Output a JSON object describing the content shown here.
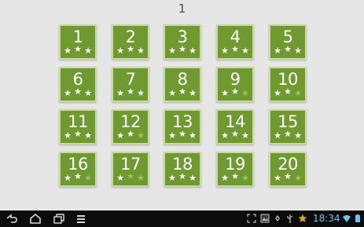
{
  "page": {
    "number": "1"
  },
  "levels": [
    {
      "label": "1",
      "stars": 3
    },
    {
      "label": "2",
      "stars": 3
    },
    {
      "label": "3",
      "stars": 3
    },
    {
      "label": "4",
      "stars": 3
    },
    {
      "label": "5",
      "stars": 3
    },
    {
      "label": "6",
      "stars": 3
    },
    {
      "label": "7",
      "stars": 3
    },
    {
      "label": "8",
      "stars": 3
    },
    {
      "label": "9",
      "stars": 2
    },
    {
      "label": "10",
      "stars": 2
    },
    {
      "label": "11",
      "stars": 3
    },
    {
      "label": "12",
      "stars": 2
    },
    {
      "label": "13",
      "stars": 3
    },
    {
      "label": "14",
      "stars": 3
    },
    {
      "label": "15",
      "stars": 3
    },
    {
      "label": "16",
      "stars": 2
    },
    {
      "label": "17",
      "stars": 1
    },
    {
      "label": "18",
      "stars": 3
    },
    {
      "label": "19",
      "stars": 2
    },
    {
      "label": "20",
      "stars": 2
    }
  ],
  "status_bar": {
    "time": "18:34"
  },
  "colors": {
    "tile": "#6e9a2f",
    "tile_border": "#c9dca0",
    "star_on": "#ffffff",
    "star_off": "#9ec25f",
    "clock": "#6fc3ea"
  },
  "icons": [
    "back-icon",
    "home-icon",
    "recent-apps-icon",
    "menu-icon",
    "screenshot-icon",
    "gallery-icon",
    "android-debug-icon",
    "usb-icon",
    "favorite-star-icon",
    "wifi-icon",
    "battery-icon"
  ]
}
